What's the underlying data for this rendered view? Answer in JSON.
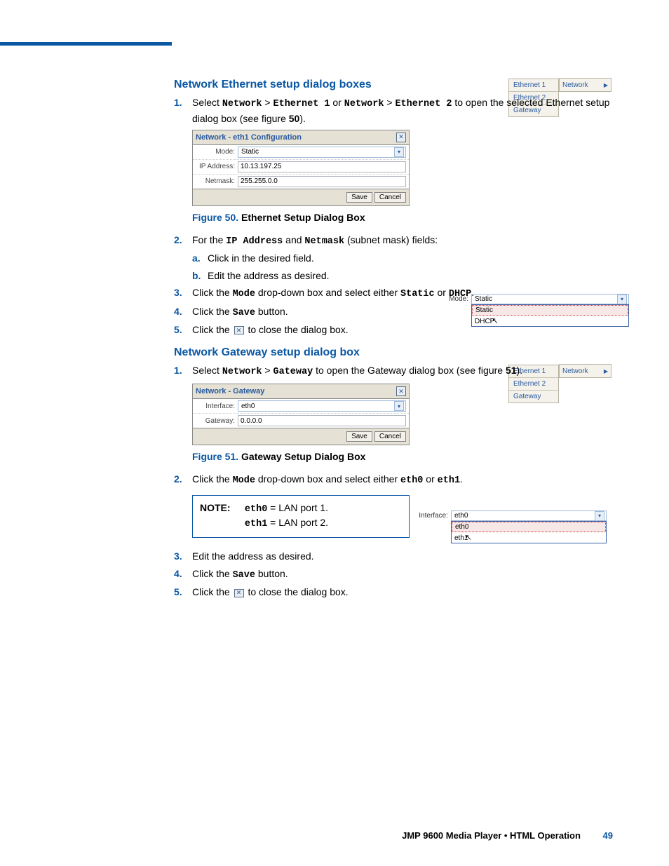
{
  "sections": {
    "eth_title": "Network Ethernet setup dialog boxes",
    "gw_title": "Network Gateway setup dialog box"
  },
  "eth_steps": {
    "s1_pre": "Select ",
    "s1_nw": "Network",
    "s1_gt": " > ",
    "s1_e1": "Ethernet 1",
    "s1_or": " or ",
    "s1_e2": "Ethernet 2",
    "s1_post": " to open the selected Ethernet setup dialog box (see figure ",
    "s1_fig": "50",
    "s1_end": ").",
    "s2_pre": "For the ",
    "s2_ip": "IP Address",
    "s2_and": " and ",
    "s2_nm": "Netmask",
    "s2_post": " (subnet mask) fields:",
    "s2a": "Click in the desired field.",
    "s2b": "Edit the address as desired.",
    "s3_pre": "Click the ",
    "s3_mode": "Mode",
    "s3_post": " drop-down box and select either ",
    "s3_static": "Static",
    "s3_or": " or ",
    "s3_dhcp": "DHCP",
    "s3_end": ".",
    "s4_pre": "Click the ",
    "s4_save": "Save",
    "s4_post": " button.",
    "s5_pre": "Click the ",
    "s5_post": " to close the dialog box."
  },
  "gw_steps": {
    "s1_pre": "Select ",
    "s1_nw": "Network",
    "s1_gt": " > ",
    "s1_gw": "Gateway",
    "s1_post": " to open the Gateway dialog box (see figure ",
    "s1_fig": "51",
    "s1_end": ").",
    "s2_pre": "Click the ",
    "s2_mode": "Mode",
    "s2_post": " drop-down box and select either ",
    "s2_e0": "eth0",
    "s2_or": " or ",
    "s2_e1": "eth1",
    "s2_end": ".",
    "s3": "Edit the address as desired.",
    "s4_pre": "Click the ",
    "s4_save": "Save",
    "s4_post": " button.",
    "s5_pre": "Click the ",
    "s5_post": " to close the dialog box."
  },
  "dlg_eth": {
    "title": "Network - eth1 Configuration",
    "mode_label": "Mode:",
    "mode_value": "Static",
    "ip_label": "IP Address:",
    "ip_value": "10.13.197.25",
    "nm_label": "Netmask:",
    "nm_value": "255.255.0.0",
    "save": "Save",
    "cancel": "Cancel"
  },
  "dlg_gw": {
    "title": "Network - Gateway",
    "if_label": "Interface:",
    "if_value": "eth0",
    "gw_label": "Gateway:",
    "gw_value": "0.0.0.0",
    "save": "Save",
    "cancel": "Cancel"
  },
  "fig50": {
    "num": "Figure 50.",
    "txt": " Ethernet Setup Dialog Box"
  },
  "fig51": {
    "num": "Figure 51.",
    "txt": " Gateway Setup Dialog Box"
  },
  "menu": {
    "e1": "Ethernet 1",
    "e2": "Ethernet 2",
    "gw": "Gateway",
    "nw": "Network"
  },
  "mode_ill": {
    "label": "Mode:",
    "sel": "Static",
    "opt1": "Static",
    "opt2": "DHCP"
  },
  "if_ill": {
    "label": "Interface:",
    "sel": "eth0",
    "opt1": "eth0",
    "opt2": "eth1"
  },
  "note": {
    "label": "NOTE:",
    "l1a": "eth0",
    "l1b": " = LAN port 1.",
    "l2a": "eth1",
    "l2b": " = LAN port 2."
  },
  "footer": {
    "title": "JMP 9600 Media Player • HTML Operation",
    "page": "49"
  },
  "nums": {
    "n1": "1.",
    "n2": "2.",
    "n3": "3.",
    "n4": "4.",
    "n5": "5.",
    "a": "a.",
    "b": "b."
  },
  "glyph": {
    "x": "✕",
    "tri": "▶",
    "dd": "▾",
    "cur": "↖"
  }
}
